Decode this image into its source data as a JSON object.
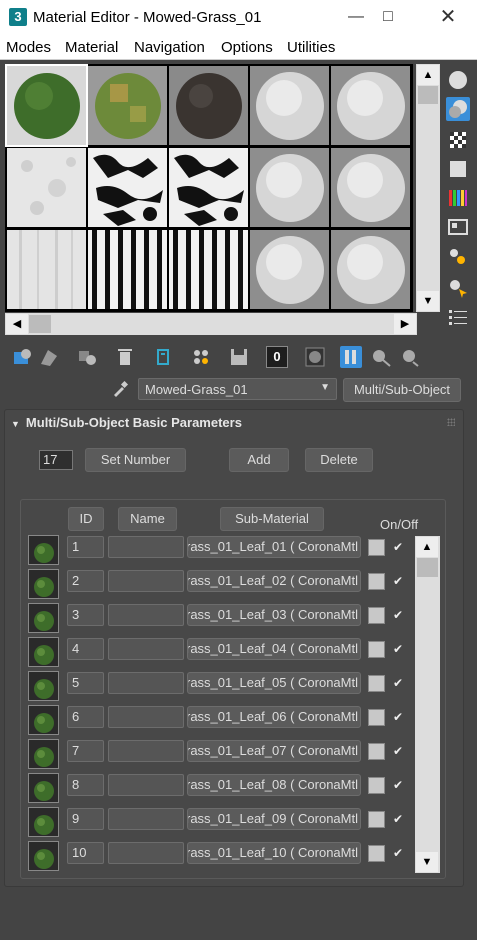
{
  "window": {
    "title": "Material Editor - Mowed-Grass_01",
    "app_icon": "3"
  },
  "menu": [
    "Modes",
    "Material",
    "Navigation",
    "Options",
    "Utilities"
  ],
  "material_name": "Mowed-Grass_01",
  "material_type": "Multi/Sub-Object",
  "rollout_title": "Multi/Sub-Object Basic Parameters",
  "number_of_materials": "17",
  "buttons": {
    "set_number": "Set Number",
    "add": "Add",
    "delete": "Delete"
  },
  "columns": {
    "id": "ID",
    "name": "Name",
    "sub_material": "Sub-Material",
    "on_off": "On/Off"
  },
  "rows": [
    {
      "id": "1",
      "sub": "rass_01_Leaf_01  ( CoronaMtl"
    },
    {
      "id": "2",
      "sub": "rass_01_Leaf_02  ( CoronaMtl"
    },
    {
      "id": "3",
      "sub": "rass_01_Leaf_03  ( CoronaMtl"
    },
    {
      "id": "4",
      "sub": "rass_01_Leaf_04  ( CoronaMtl"
    },
    {
      "id": "5",
      "sub": "rass_01_Leaf_05  ( CoronaMtl"
    },
    {
      "id": "6",
      "sub": "rass_01_Leaf_06  ( CoronaMtl"
    },
    {
      "id": "7",
      "sub": "rass_01_Leaf_07  ( CoronaMtl"
    },
    {
      "id": "8",
      "sub": "rass_01_Leaf_08  ( CoronaMtl"
    },
    {
      "id": "9",
      "sub": "rass_01_Leaf_09  ( CoronaMtl"
    },
    {
      "id": "10",
      "sub": "rass_01_Leaf_10  ( CoronaMtl"
    }
  ],
  "toolbar": {
    "zero_label": "0"
  },
  "slot_types": [
    "green-sphere",
    "green-patch-sphere",
    "dark-sphere",
    "white-sphere",
    "white-sphere",
    "white-noise",
    "black-white-noise",
    "black-white-noise",
    "white-sphere",
    "white-sphere",
    "white-streaks",
    "black-white-stripes",
    "black-white-stripes",
    "white-sphere",
    "white-sphere"
  ],
  "colors": {
    "panel": "#444444",
    "accent_blue": "#3a8fd9"
  }
}
